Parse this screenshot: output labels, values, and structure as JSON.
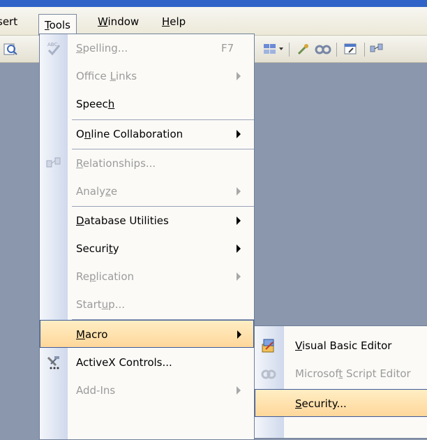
{
  "menubar": {
    "items": [
      {
        "pre": "",
        "ul": "",
        "post": "sert"
      },
      {
        "pre": "",
        "ul": "T",
        "post": "ools"
      },
      {
        "pre": "",
        "ul": "W",
        "post": "indow"
      },
      {
        "pre": "",
        "ul": "H",
        "post": "elp"
      }
    ]
  },
  "tools_menu": {
    "items": [
      {
        "pre": "",
        "ul": "S",
        "post": "pelling...",
        "shortcut": "F7",
        "icon": "spelling-icon",
        "state": "disabled"
      },
      {
        "pre": "Office ",
        "ul": "L",
        "post": "inks",
        "icon": "",
        "state": "disabled",
        "submenu": true
      },
      {
        "pre": "Speec",
        "ul": "h",
        "post": "",
        "icon": "",
        "state": "enabled"
      },
      {
        "pre": "O",
        "ul": "n",
        "post": "line Collaboration",
        "icon": "",
        "state": "enabled",
        "submenu": true
      },
      {
        "pre": "",
        "ul": "R",
        "post": "elationships...",
        "icon": "relationships-icon",
        "state": "disabled"
      },
      {
        "pre": "Analy",
        "ul": "z",
        "post": "e",
        "icon": "",
        "state": "disabled",
        "submenu": true
      },
      {
        "pre": "",
        "ul": "D",
        "post": "atabase Utilities",
        "icon": "",
        "state": "enabled",
        "submenu": true
      },
      {
        "pre": "Securi",
        "ul": "t",
        "post": "y",
        "icon": "",
        "state": "enabled",
        "submenu": true
      },
      {
        "pre": "Re",
        "ul": "p",
        "post": "lication",
        "icon": "",
        "state": "disabled",
        "submenu": true
      },
      {
        "pre": "Start",
        "ul": "u",
        "post": "p...",
        "icon": "",
        "state": "disabled"
      },
      {
        "pre": "",
        "ul": "M",
        "post": "acro",
        "icon": "",
        "state": "highlighted",
        "submenu": true
      },
      {
        "pre": "ActiveX Controls...",
        "ul": "",
        "post": "",
        "icon": "activex-controls-icon",
        "state": "enabled"
      },
      {
        "pre": "Add-Ins",
        "ul": "",
        "post": "",
        "icon": "",
        "state": "disabled",
        "submenu": true
      }
    ]
  },
  "macro_submenu": {
    "items": [
      {
        "pre": "",
        "ul": "V",
        "post": "isual Basic Editor",
        "icon": "visual-basic-editor-icon",
        "state": "enabled"
      },
      {
        "pre": "Microsof",
        "ul": "t",
        "post": " Script Editor",
        "icon": "script-editor-icon",
        "state": "disabled"
      },
      {
        "pre": "",
        "ul": "S",
        "post": "ecurity...",
        "icon": "",
        "state": "highlighted"
      }
    ]
  },
  "colors": {
    "highlight": "#ffd79a",
    "highlight_border": "#3d5a9c",
    "disabled_text": "#9b9b9b",
    "workspace": "#8a97ad",
    "title_bar": "#2f63c8"
  }
}
